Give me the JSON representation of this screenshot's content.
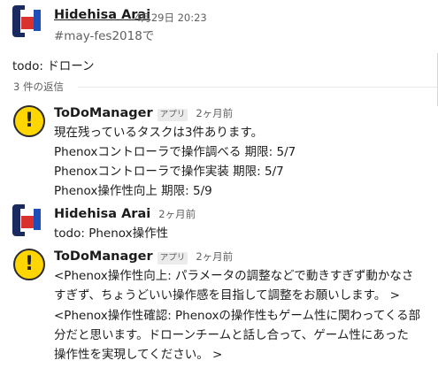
{
  "parent": {
    "author": "Hidehisa Arai",
    "timestamp": "4月29日 20:23",
    "channel_line": "#may-fes2018で",
    "body": "todo: ドローン"
  },
  "thread": {
    "replies_count": "3 件の返信"
  },
  "messages": [
    {
      "author": "ToDoManager",
      "badge": "アプリ",
      "time": "2ヶ月前",
      "lines": [
        "現在残っているタスクは3件あります。",
        "Phenoxコントローラで操作調べる 期限: 5/7",
        "Phenoxコントローラで操作実装 期限: 5/7",
        "Phenox操作性向上 期限: 5/9"
      ]
    },
    {
      "author": "Hidehisa Arai",
      "time": "2ヶ月前",
      "lines": [
        "todo: Phenox操作性"
      ]
    },
    {
      "author": "ToDoManager",
      "badge": "アプリ",
      "time": "2ヶ月前",
      "lines": [
        "<Phenox操作性向上: パラメータの調整などで動きすぎず動かなさ",
        "すぎず、ちょうどいい操作感を目指して調整をお願いします。 >",
        "<Phenox操作性確認: Phenoxの操作性もゲーム性に関わってくる部",
        "分だと思います。ドローンチームと話し合って、ゲーム性にあった",
        "操作性を実現してください。 >"
      ]
    }
  ],
  "colors": {
    "warn_avatar": "#ffd600",
    "avatar_red": "#d9312b",
    "avatar_blue": "#1d4fb8",
    "avatar_navy": "#1a2a5e",
    "muted_text": "#616061"
  },
  "icons": {
    "bot_avatar": "exclamation-icon",
    "user_avatar": "flag-avatar"
  }
}
